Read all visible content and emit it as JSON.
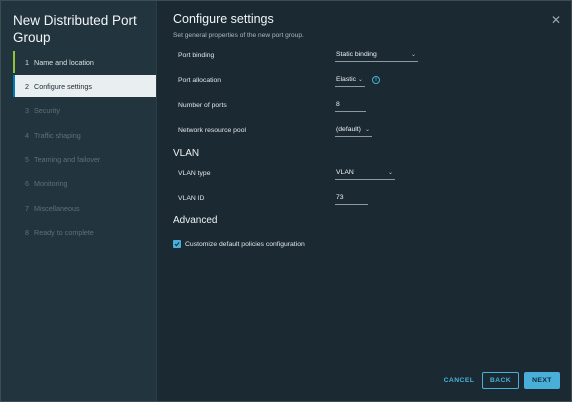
{
  "wizard": {
    "title": "New Distributed Port Group"
  },
  "sidebar": {
    "steps": [
      {
        "num": "1",
        "label": "Name and location",
        "state": "done"
      },
      {
        "num": "2",
        "label": "Configure settings",
        "state": "active"
      },
      {
        "num": "3",
        "label": "Security",
        "state": "disabled"
      },
      {
        "num": "4",
        "label": "Traffic shaping",
        "state": "disabled"
      },
      {
        "num": "5",
        "label": "Teaming and failover",
        "state": "disabled"
      },
      {
        "num": "6",
        "label": "Monitoring",
        "state": "disabled"
      },
      {
        "num": "7",
        "label": "Miscellaneous",
        "state": "disabled"
      },
      {
        "num": "8",
        "label": "Ready to complete",
        "state": "disabled"
      }
    ]
  },
  "main": {
    "title": "Configure settings",
    "subtitle": "Set general properties of the new port group.",
    "close_icon": "close-icon"
  },
  "form": {
    "port_binding": {
      "label": "Port binding",
      "value": "Static binding"
    },
    "port_allocation": {
      "label": "Port allocation",
      "value": "Elastic",
      "info_icon": "info-icon",
      "info_glyph": "i"
    },
    "number_of_ports": {
      "label": "Number of ports",
      "value": "8"
    },
    "network_resource_pool": {
      "label": "Network resource pool",
      "value": "(default)"
    }
  },
  "vlan": {
    "title": "VLAN",
    "vlan_type": {
      "label": "VLAN type",
      "value": "VLAN"
    },
    "vlan_id": {
      "label": "VLAN ID",
      "value": "73"
    }
  },
  "advanced": {
    "title": "Advanced",
    "customize": {
      "label": "Customize default policies configuration",
      "checked": true
    }
  },
  "footer": {
    "cancel_label": "CANCEL",
    "back_label": "BACK",
    "next_label": "NEXT"
  },
  "colors": {
    "accent": "#49afd9",
    "background": "#1b2a32",
    "sidebar": "#22343d",
    "active_step": "#e9eef1",
    "done_marker": "#8fc43b"
  }
}
